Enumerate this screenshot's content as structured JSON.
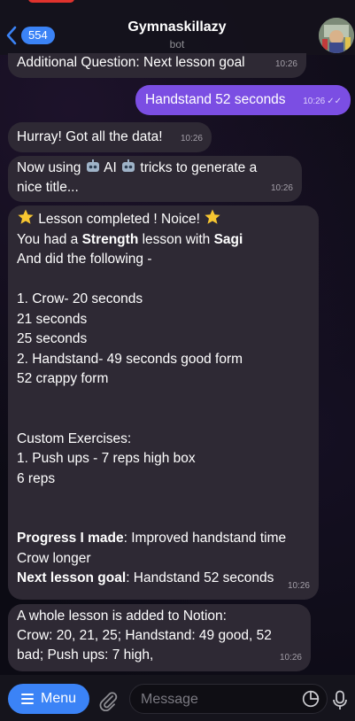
{
  "header": {
    "back_count": "554",
    "title": "Gymnaskillazy",
    "subtitle": "bot"
  },
  "messages": {
    "m1": {
      "text": "Additional Question: Next lesson goal",
      "time": "10:26"
    },
    "m2": {
      "text": "Handstand 52 seconds",
      "time": "10:26"
    },
    "m3": {
      "text": "Hurray! Got all the data!",
      "time": "10:26"
    },
    "m4": {
      "a": "Now using ",
      "ai": " AI ",
      "b": " tricks to generate a",
      "c": "nice title...",
      "time": "10:26"
    },
    "m5": {
      "l1": " Lesson completed ! Noice! ",
      "l2a": "You had a ",
      "l2b": "Strength",
      "l2c": " lesson with ",
      "l2d": "Sagi",
      "l3": "And did the following -",
      "l4": "1. Crow- 20 seconds",
      "l5": "21 seconds",
      "l6": "25 seconds",
      "l7": "2. Handstand- 49 seconds good form",
      "l8": "52 crappy form",
      "l9": "Custom Exercises:",
      "l10": "1. Push ups - 7 reps high box",
      "l11": "6 reps",
      "l12a": "Progress I made",
      "l12b": ": Improved handstand time",
      "l13": "Crow longer",
      "l14a": "Next lesson goal",
      "l14b": ": Handstand 52 seconds",
      "time": "10:26"
    },
    "m6": {
      "l1": "A whole lesson is added to Notion:",
      "l2": "Crow: 20, 21, 25; Handstand: 49 good, 52",
      "l3": "bad; Push ups: 7 high,",
      "time": "10:26"
    }
  },
  "composer": {
    "menu_label": "Menu",
    "placeholder": "Message"
  },
  "colors": {
    "accent": "#3b83f6",
    "outgoing_bubble": "#7b4ee3",
    "incoming_bubble": "#2e2934"
  },
  "icons": [
    "chevron-left-icon",
    "robot-icon",
    "star-icon",
    "menu-icon",
    "paperclip-icon",
    "sticker-icon",
    "microphone-icon",
    "double-check-icon"
  ]
}
